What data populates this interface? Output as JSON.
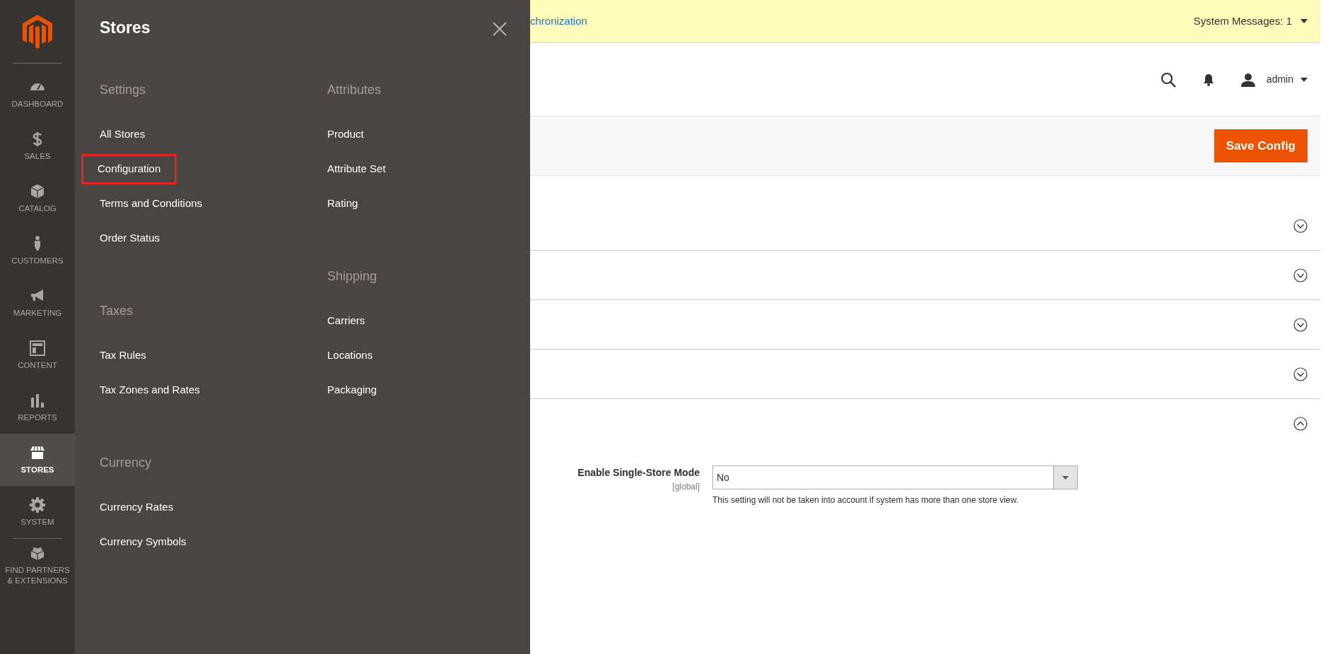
{
  "sidebar": {
    "items": [
      {
        "label": "DASHBOARD",
        "selected": false
      },
      {
        "label": "SALES",
        "selected": false
      },
      {
        "label": "CATALOG",
        "selected": false
      },
      {
        "label": "CUSTOMERS",
        "selected": false
      },
      {
        "label": "MARKETING",
        "selected": false
      },
      {
        "label": "CONTENT",
        "selected": false
      },
      {
        "label": "REPORTS",
        "selected": false
      },
      {
        "label": "STORES",
        "selected": true
      },
      {
        "label": "SYSTEM",
        "selected": false
      },
      {
        "label": "FIND PARTNERS & EXTENSIONS",
        "selected": false
      }
    ]
  },
  "menu": {
    "title": "Stores",
    "columns": [
      {
        "groups": [
          {
            "heading": "Settings",
            "items": [
              {
                "label": "All Stores",
                "highlighted": false
              },
              {
                "label": "Configuration",
                "highlighted": true
              },
              {
                "label": "Terms and Conditions",
                "highlighted": false
              },
              {
                "label": "Order Status",
                "highlighted": false
              }
            ]
          },
          {
            "heading": "Taxes",
            "items": [
              {
                "label": "Tax Rules",
                "highlighted": false
              },
              {
                "label": "Tax Zones and Rates",
                "highlighted": false
              }
            ]
          },
          {
            "heading": "Currency",
            "items": [
              {
                "label": "Currency Rates",
                "highlighted": false
              },
              {
                "label": "Currency Symbols",
                "highlighted": false
              }
            ]
          }
        ]
      },
      {
        "groups": [
          {
            "heading": "Attributes",
            "items": [
              {
                "label": "Product",
                "highlighted": false
              },
              {
                "label": "Attribute Set",
                "highlighted": false
              },
              {
                "label": "Rating",
                "highlighted": false
              }
            ]
          },
          {
            "heading": "Shipping",
            "items": [
              {
                "label": "Carriers",
                "highlighted": false
              },
              {
                "label": "Locations",
                "highlighted": false
              },
              {
                "label": "Packaging",
                "highlighted": false
              }
            ]
          }
        ]
      }
    ]
  },
  "message_bar": {
    "link": "chronization",
    "system_messages": "System Messages: 1"
  },
  "header": {
    "user": "admin"
  },
  "actions": {
    "save_button": "Save Config"
  },
  "sections": [
    {
      "expanded": false
    },
    {
      "expanded": false
    },
    {
      "expanded": false
    },
    {
      "expanded": false
    },
    {
      "expanded": true
    }
  ],
  "field": {
    "label": "Enable Single-Store Mode",
    "scope": "[global]",
    "value": "No",
    "note": "This setting will not be taken into account if system has more than one store view."
  }
}
